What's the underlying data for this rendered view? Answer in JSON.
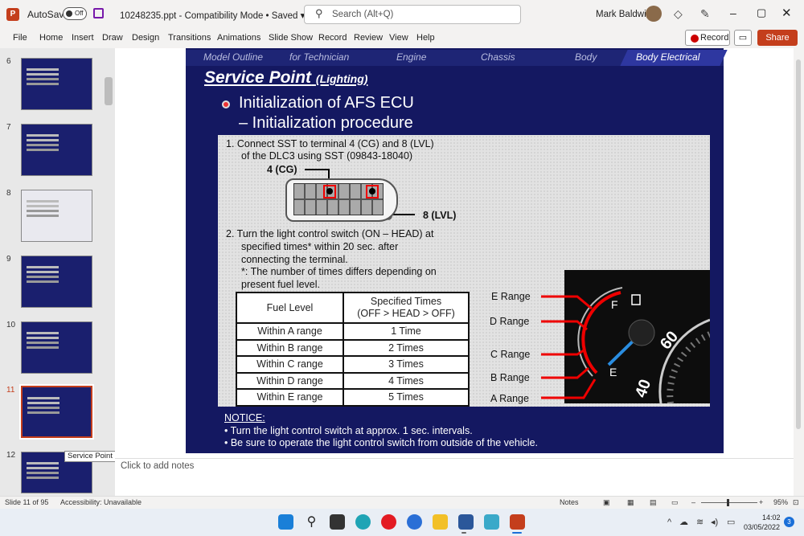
{
  "window": {
    "logo": "P",
    "autosave_label": "AutoSave",
    "autosave_state": "Off",
    "doc_title": "10248235.ppt  -  Compatibility Mode • Saved  ▾",
    "search_placeholder": "Search (Alt+Q)",
    "user_name": "Mark Baldwin"
  },
  "ribbon": {
    "tabs": [
      "File",
      "Home",
      "Insert",
      "Draw",
      "Design",
      "Transitions",
      "Animations",
      "Slide Show",
      "Record",
      "Review",
      "View",
      "Help"
    ],
    "record_label": "Record",
    "share_label": "Share"
  },
  "thumbnails": {
    "numbers": [
      "6",
      "7",
      "8",
      "9",
      "10",
      "11",
      "12"
    ],
    "selected": "11",
    "tooltip": "Service Point (Lighting)"
  },
  "slide": {
    "nav": [
      "Model Outline",
      "for Technician",
      "Engine",
      "Chassis",
      "Body",
      "Body Electrical"
    ],
    "title": "Service Point",
    "title_sub": "(Lighting)",
    "heading_1": "Initialization of AFS ECU",
    "heading_2": "– Initialization procedure",
    "step1_line1": "1.  Connect SST to terminal 4 (CG) and 8 (LVL)",
    "step1_line2": "of the DLC3 using SST (09843-18040)",
    "label_4": "4 (CG)",
    "label_8": "8 (LVL)",
    "step2_lines": [
      "2.  Turn the light control switch (ON – HEAD) at",
      "specified times* within 20 sec. after",
      "connecting the terminal.",
      "*: The number of times differs depending on",
      "present fuel level."
    ],
    "table": {
      "header_left": "Fuel Level",
      "header_right_1": "Specified Times",
      "header_right_2": "(OFF > HEAD > OFF)",
      "rows": [
        [
          "Within A range",
          "1 Time"
        ],
        [
          "Within B range",
          "2 Times"
        ],
        [
          "Within C range",
          "3 Times"
        ],
        [
          "Within D range",
          "4 Times"
        ],
        [
          "Within E range",
          "5 Times"
        ]
      ]
    },
    "ranges": [
      "E Range",
      "D Range",
      "C Range",
      "B Range",
      "A Range"
    ],
    "gauge": {
      "full": "F",
      "empty": "E",
      "speed_60": "60",
      "speed_40": "40"
    },
    "notice_head": "NOTICE:",
    "notices": [
      "•  Turn the light control switch at approx. 1 sec. intervals.",
      "•  Be sure to operate the light control switch from outside of the vehicle."
    ]
  },
  "notes_placeholder": "Click to add notes",
  "status": {
    "slide_count": "Slide 11 of 95",
    "accessibility": "Accessibility: Unavailable",
    "notes": "Notes",
    "zoom": "95%"
  },
  "taskbar": {
    "time": "14:02",
    "date": "03/05/2022",
    "notifications": "3"
  }
}
